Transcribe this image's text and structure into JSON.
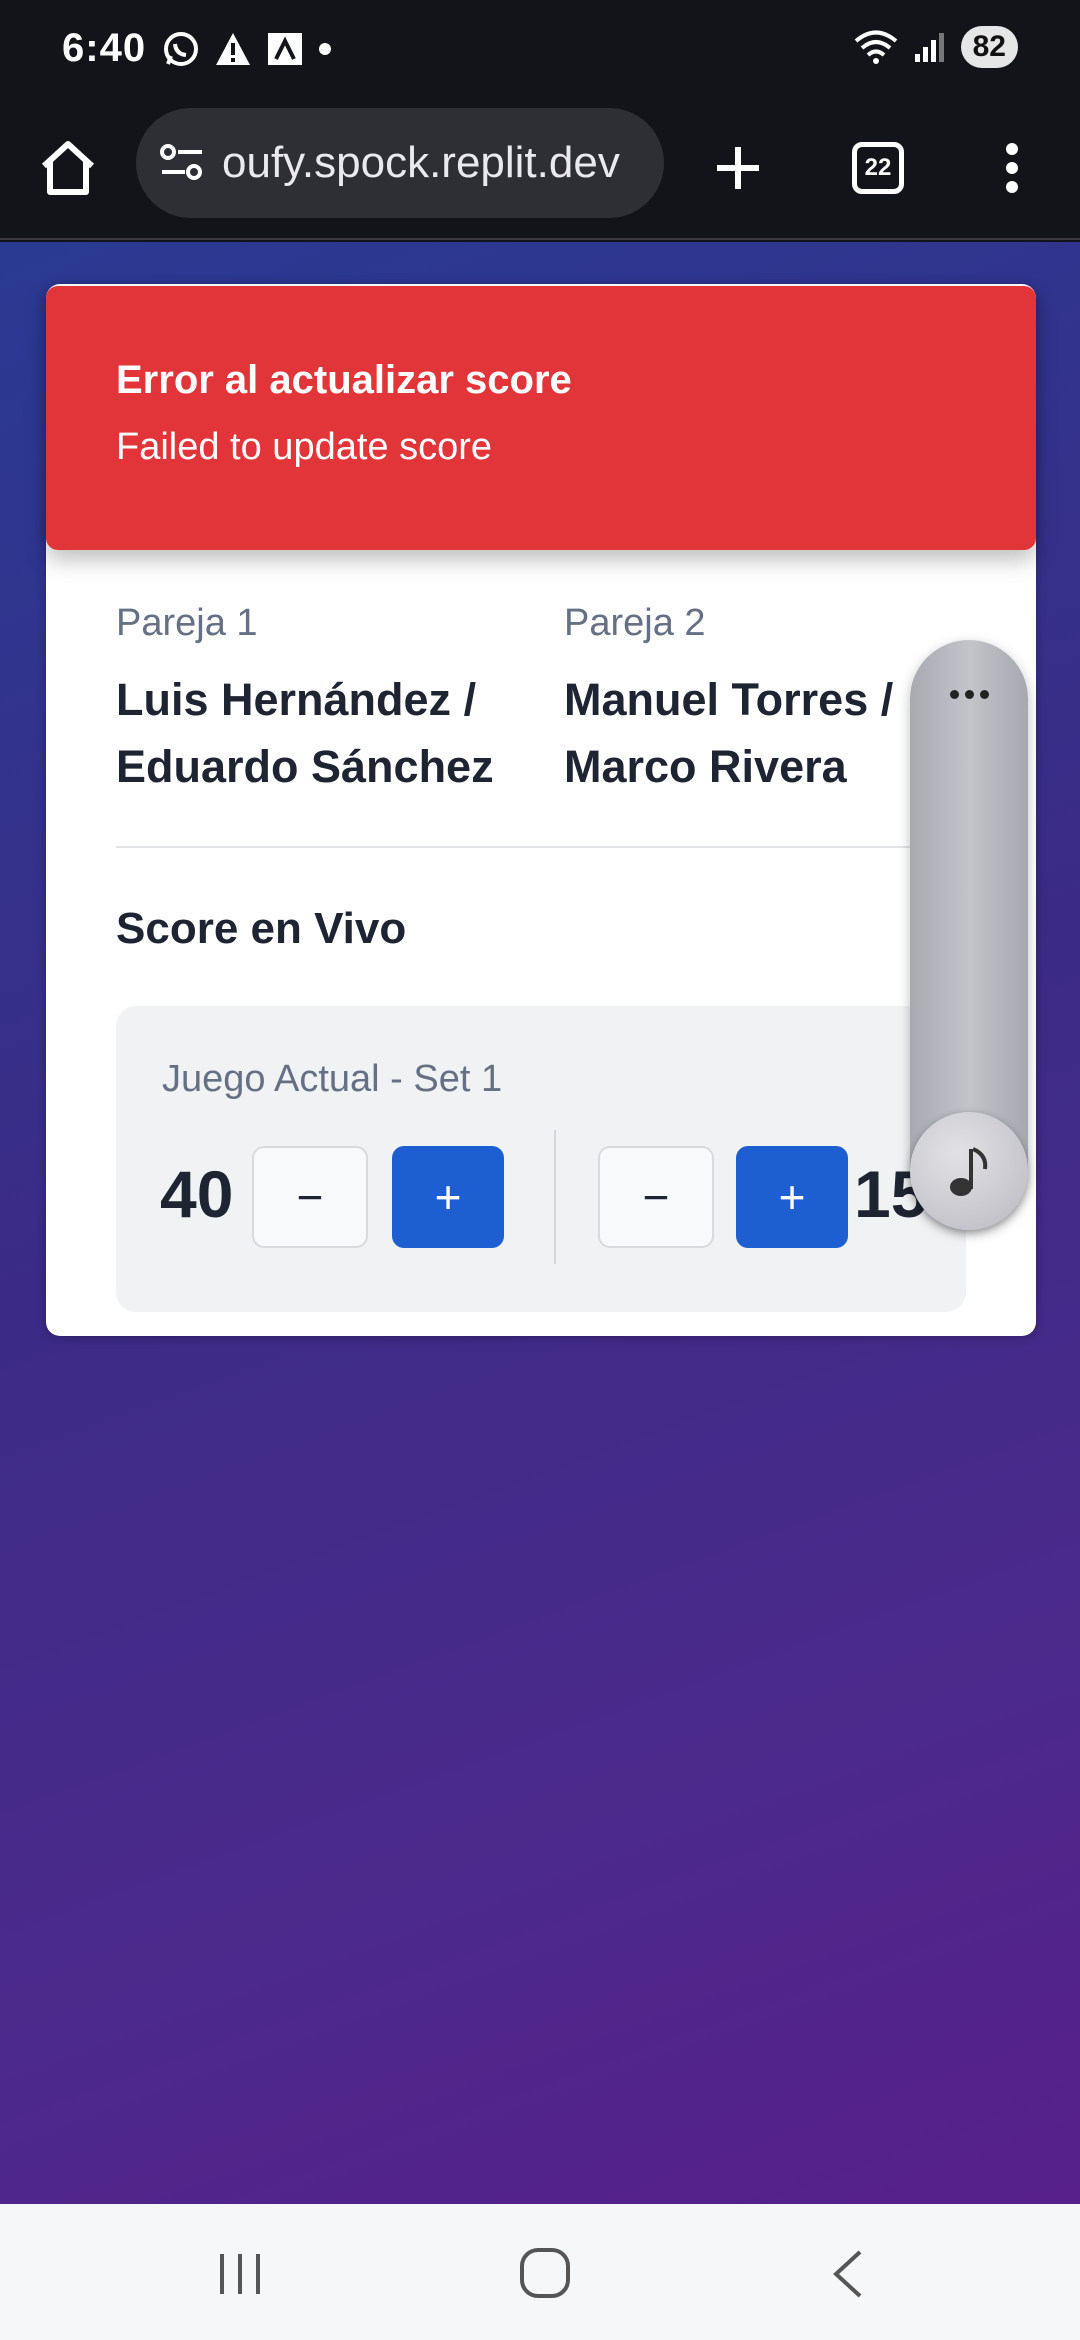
{
  "status_bar": {
    "time": "6:40",
    "battery": "82",
    "left_icons": [
      "whatsapp-icon",
      "warning-icon",
      "autofill-icon",
      "dot-icon"
    ],
    "right_icons": [
      "wifi-icon",
      "signal-icon"
    ]
  },
  "browser": {
    "url": "oufy.spock.replit.dev",
    "tab_count": "22"
  },
  "toast": {
    "title": "Error al actualizar score",
    "message": "Failed to update score",
    "color": "#e23539"
  },
  "match": {
    "pair1_label": "Pareja 1",
    "pair1_line1": "Luis Hernández /",
    "pair1_line2": "Eduardo Sánchez",
    "pair2_label": "Pareja 2",
    "pair2_line1": "Manuel Torres /",
    "pair2_line2": "Marco Rivera"
  },
  "score": {
    "section_title": "Score en Vivo",
    "game_label": "Juego Actual - Set 1",
    "pair1_points": "40",
    "pair2_points": "15",
    "minus_label": "−",
    "plus_label": "+",
    "accent": "#1d5fd0"
  }
}
